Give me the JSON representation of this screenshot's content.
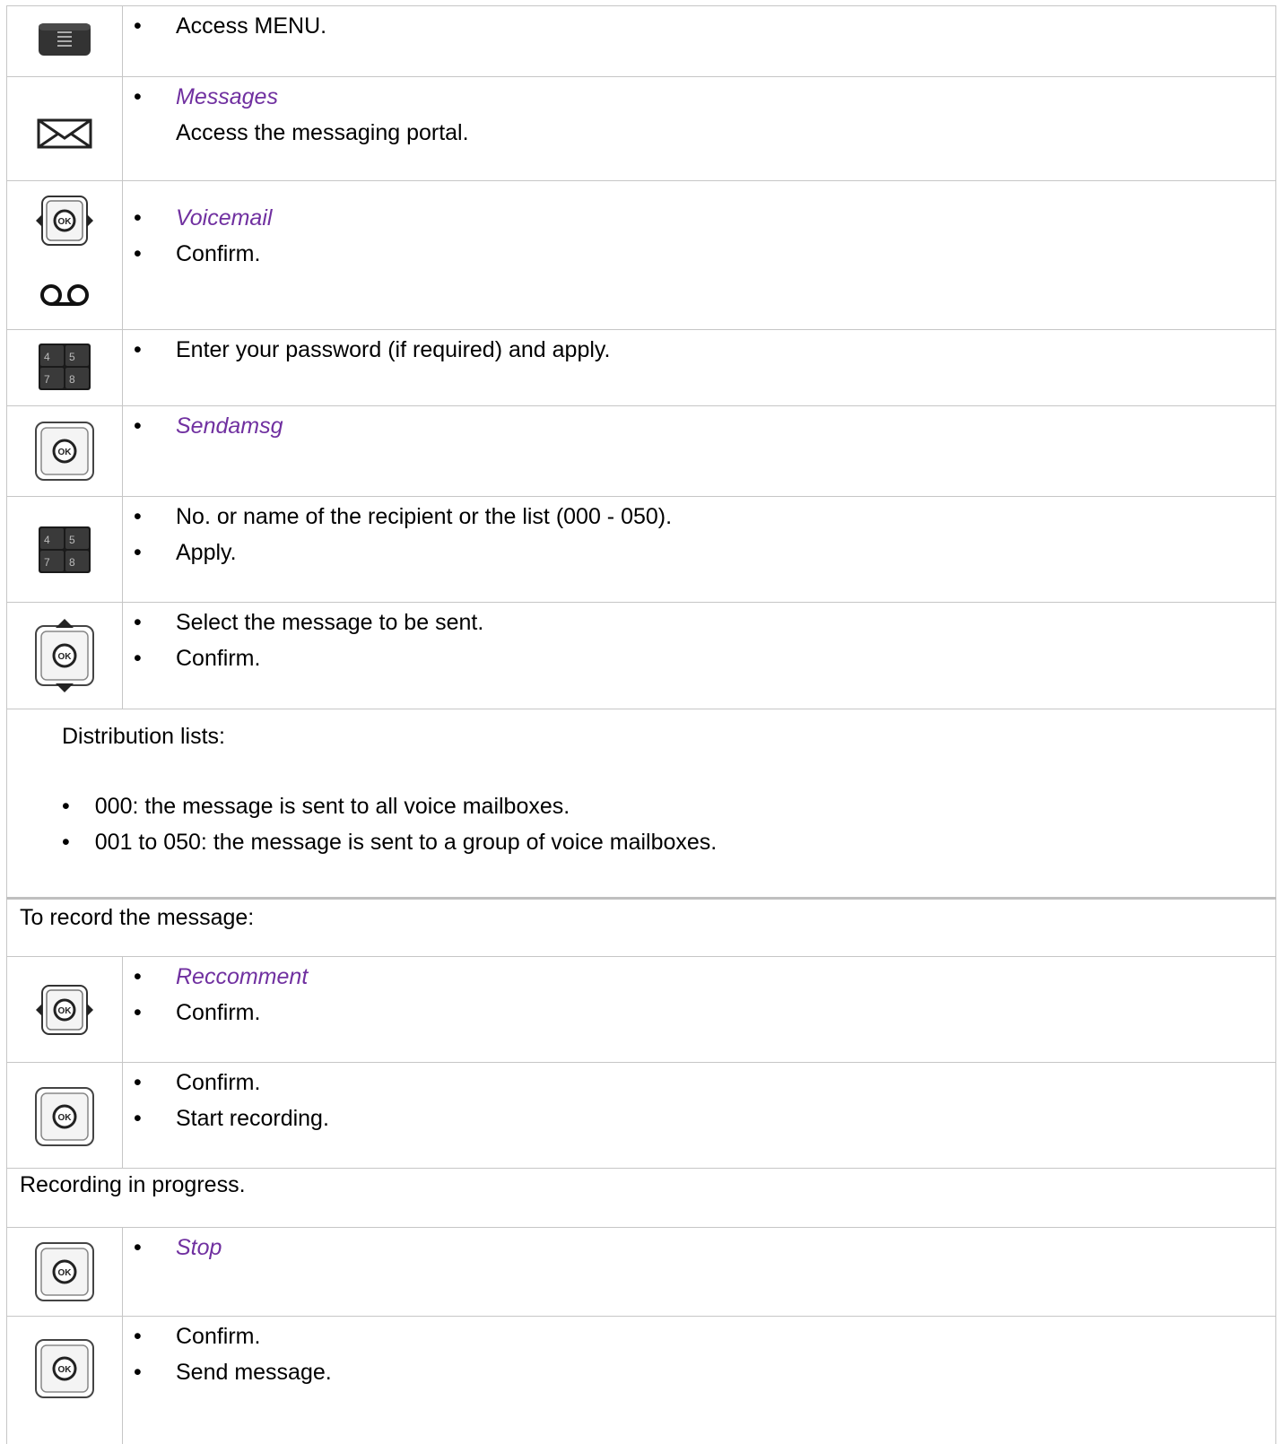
{
  "steps": [
    {
      "items": [
        "Access MENU."
      ]
    },
    {
      "items": [
        "Messages",
        "Access the messaging portal."
      ]
    },
    {
      "items": [
        "Voicemail",
        "Confirm."
      ]
    },
    {
      "items": [
        "Enter your password (if required) and apply."
      ]
    },
    {
      "items": [
        "Sendamsg"
      ]
    },
    {
      "items": [
        "No. or name of the recipient or the list (000 - 050).",
        "Apply."
      ]
    },
    {
      "items": [
        "Select the message to be sent.",
        "Confirm."
      ]
    }
  ],
  "distribution": {
    "title": "Distribution lists:",
    "items": [
      "000: the message is sent to all voice mailboxes.",
      "001 to 050: the message is sent to a group of voice mailboxes."
    ]
  },
  "record_header": "To record the message:",
  "record_steps": [
    {
      "items": [
        "Reccomment",
        "Confirm."
      ]
    },
    {
      "items": [
        "Confirm.",
        "Start recording."
      ]
    }
  ],
  "progress_text": "Recording in progress.",
  "final_steps": [
    {
      "items": [
        "Stop"
      ]
    },
    {
      "items": [
        "Confirm.",
        "Send message."
      ]
    }
  ],
  "bullet_symbol": "•",
  "accent_color": "#7030a0"
}
